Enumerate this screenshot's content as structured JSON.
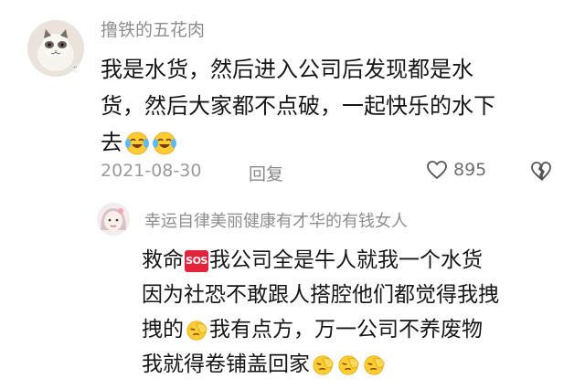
{
  "comment1": {
    "username": "撸铁的五花肉",
    "lines": [
      "我是水货，然后进入公司后发现都是水",
      "货，然后大家都不点破，一起快乐的水下",
      "去"
    ],
    "emoji_after": [
      "laughing-crying-icon",
      "laughing-crying-icon"
    ],
    "date": "2021-08-30",
    "reply_label": "回复",
    "like_count": "895"
  },
  "comment2": {
    "username": "幸运自律美丽健康有才华的有钱女人",
    "sos_badge": "SOS",
    "lines": [
      "救命",
      "我公司全是牛人就我一个水货",
      "因为社恐不敢跟人搭腔他们都觉得我拽",
      "拽的",
      "我有点方，万一公司不养废物",
      "我就得卷铺盖回家"
    ]
  },
  "colors": {
    "username": "#8e8e8e",
    "text": "#161616",
    "meta": "#9a9a9a",
    "sos": "#e3243b"
  }
}
